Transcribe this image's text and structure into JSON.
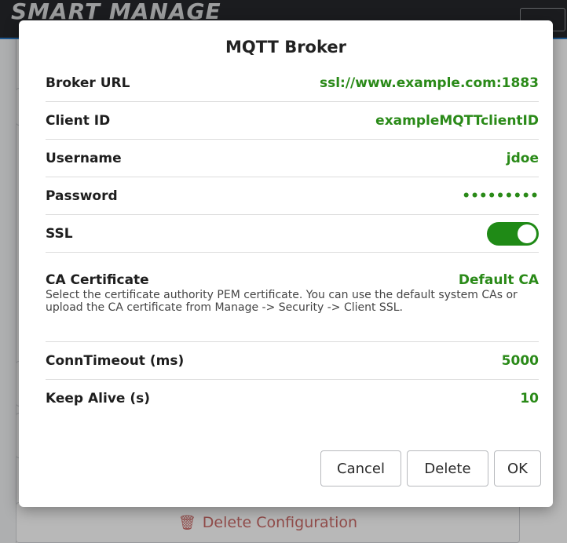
{
  "background": {
    "logo_text": "SMART MANAGE",
    "delete_configuration_label": "Delete Configuration",
    "trash_icon": "trash-icon"
  },
  "modal": {
    "title": "MQTT Broker",
    "fields": {
      "broker_url": {
        "label": "Broker URL",
        "value": "ssl://www.example.com:1883"
      },
      "client_id": {
        "label": "Client ID",
        "value": "exampleMQTTclientID"
      },
      "username": {
        "label": "Username",
        "value": "jdoe"
      },
      "password": {
        "label": "Password",
        "value": "•••••••••"
      },
      "ssl": {
        "label": "SSL",
        "enabled": true
      },
      "ca_certificate": {
        "label": "CA Certificate",
        "value": "Default CA",
        "description": "Select the certificate authority PEM certificate. You can use the default system CAs or upload the CA certificate from Manage -> Security -> Client SSL."
      },
      "conn_timeout": {
        "label": "ConnTimeout (ms)",
        "value": "5000"
      },
      "keep_alive": {
        "label": "Keep Alive (s)",
        "value": "10"
      }
    },
    "buttons": {
      "cancel": "Cancel",
      "delete": "Delete",
      "ok": "OK"
    }
  },
  "colors": {
    "value_green": "#2a8a18",
    "toggle_on": "#1f8a16",
    "header_dark": "#26282b",
    "delete_red": "#c96a67"
  }
}
